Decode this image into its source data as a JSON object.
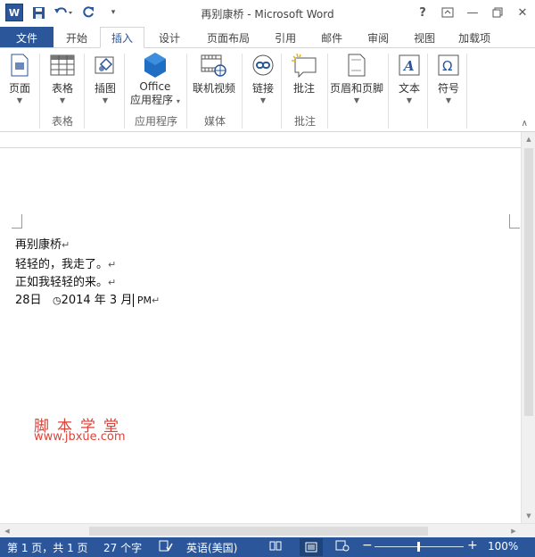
{
  "window": {
    "title": "再别康桥 - Microsoft Word",
    "help": "?",
    "logo": "W"
  },
  "tabs": [
    {
      "label": "文件",
      "name": "tab-file"
    },
    {
      "label": "开始",
      "name": "tab-home"
    },
    {
      "label": "插入",
      "name": "tab-insert",
      "active": true
    },
    {
      "label": "设计",
      "name": "tab-design"
    },
    {
      "label": "页面布局",
      "name": "tab-page-layout"
    },
    {
      "label": "引用",
      "name": "tab-references"
    },
    {
      "label": "邮件",
      "name": "tab-mailings"
    },
    {
      "label": "审阅",
      "name": "tab-review"
    },
    {
      "label": "视图",
      "name": "tab-view"
    },
    {
      "label": "加载项",
      "name": "tab-addins"
    }
  ],
  "ribbon": {
    "pages": {
      "label": "页面"
    },
    "tables": {
      "label": "表格",
      "group": "表格"
    },
    "illustrations": {
      "label": "插图"
    },
    "office_apps": {
      "label1": "Office",
      "label2": "应用程序",
      "group": "应用程序"
    },
    "online_video": {
      "label": "联机视频",
      "group": "媒体"
    },
    "links": {
      "label": "链接"
    },
    "comment": {
      "label": "批注",
      "group": "批注"
    },
    "header_footer": {
      "label": "页眉和页脚"
    },
    "text": {
      "label": "文本"
    },
    "symbols": {
      "label": "符号"
    }
  },
  "document": {
    "lines": [
      "再别康桥",
      "轻轻的，我走了。",
      "正如我轻轻的来。",
      "28日   ",
      "2014 年 3 月",
      " PM"
    ],
    "para_mark": "↵",
    "watermark_cn": "脚本学堂",
    "watermark_url": "www.jbxue.com"
  },
  "statusbar": {
    "page": "第 1 页，共 1 页",
    "words": "27 个字",
    "language": "英语(美国)",
    "zoom": "100%",
    "zoom_minus": "−",
    "zoom_plus": "+"
  },
  "colors": {
    "accent": "#2b579a",
    "watermark": "#d8453a"
  }
}
